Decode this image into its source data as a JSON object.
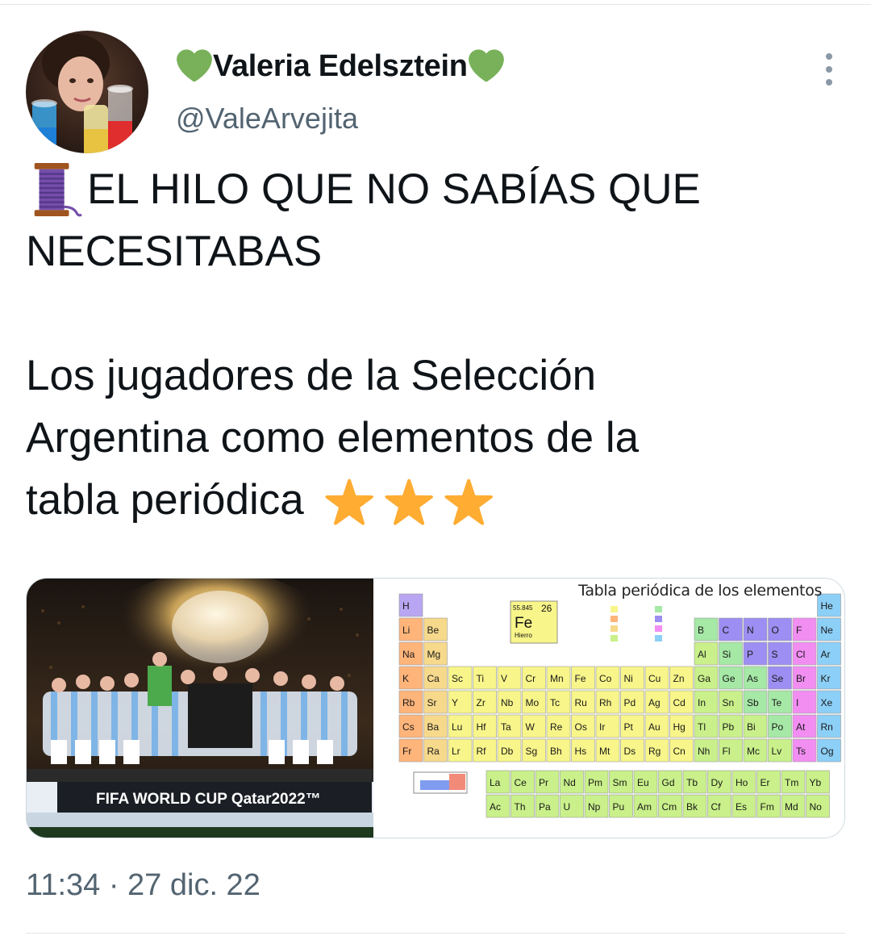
{
  "tweet": {
    "author_name": "Valeria Edelsztein",
    "author_handle": "@ValeArvejita",
    "text_line_1": "EL HILO QUE NO SABÍAS QUE",
    "text_line_2": "NECESITABAS",
    "text_line_3": "Los jugadores de la Selección",
    "text_line_4": "Argentina como elementos de la",
    "text_line_5": "tabla periódica",
    "timestamp": "11:34 · 27 dic. 22"
  },
  "icons": {
    "name_left": "green-heart-icon",
    "name_right": "green-heart-icon",
    "thread": "spool-of-thread-icon",
    "stars": [
      "star-icon",
      "star-icon",
      "star-icon"
    ],
    "more": "more-options-icon"
  },
  "media": {
    "photo_banner": "FIFA WORLD CUP Qatar2022™",
    "periodic_table_title": "Tabla periódica de los elementos",
    "periodic_table_key_symbol": "Fe",
    "periodic_table_key_number": "26",
    "periodic_table_key_mass": "55.845",
    "periodic_table_key_name": "Hierro",
    "periodic_table_symbols": [
      "H",
      "He",
      "Li",
      "Be",
      "B",
      "C",
      "N",
      "O",
      "F",
      "Ne",
      "Na",
      "Mg",
      "Al",
      "Si",
      "P",
      "S",
      "Cl",
      "Ar",
      "K",
      "Ca",
      "Sc",
      "Ti",
      "V",
      "Cr",
      "Mn",
      "Fe",
      "Co",
      "Ni",
      "Cu",
      "Zn",
      "Ga",
      "Ge",
      "As",
      "Se",
      "Br",
      "Kr",
      "Rb",
      "Sr",
      "Y",
      "Zr",
      "Nb",
      "Mo",
      "Tc",
      "Ru",
      "Rh",
      "Pd",
      "Ag",
      "Cd",
      "In",
      "Sn",
      "Sb",
      "Te",
      "I",
      "Xe",
      "Cs",
      "Ba",
      "Lu",
      "Hf",
      "Ta",
      "W",
      "Re",
      "Os",
      "Ir",
      "Pt",
      "Au",
      "Hg",
      "Tl",
      "Pb",
      "Bi",
      "Po",
      "At",
      "Rn",
      "Fr",
      "Ra",
      "Lr",
      "Rf",
      "Db",
      "Sg",
      "Bh",
      "Hs",
      "Mt",
      "Ds",
      "Rg",
      "Cn",
      "Nh",
      "Fl",
      "Mc",
      "Lv",
      "Ts",
      "Og",
      "La",
      "Ce",
      "Pr",
      "Nd",
      "Pm",
      "Sm",
      "Eu",
      "Gd",
      "Tb",
      "Dy",
      "Ho",
      "Er",
      "Tm",
      "Yb",
      "Ac",
      "Th",
      "Pa",
      "U",
      "Np",
      "Pu",
      "Am",
      "Cm",
      "Bk",
      "Cf",
      "Es",
      "Fm",
      "Md",
      "No"
    ]
  },
  "colors": {
    "text_primary": "#0f1419",
    "text_secondary": "#536471",
    "heart_green": "#78b159",
    "star_gold": "#ffac33",
    "divider": "#e6e6e6"
  }
}
